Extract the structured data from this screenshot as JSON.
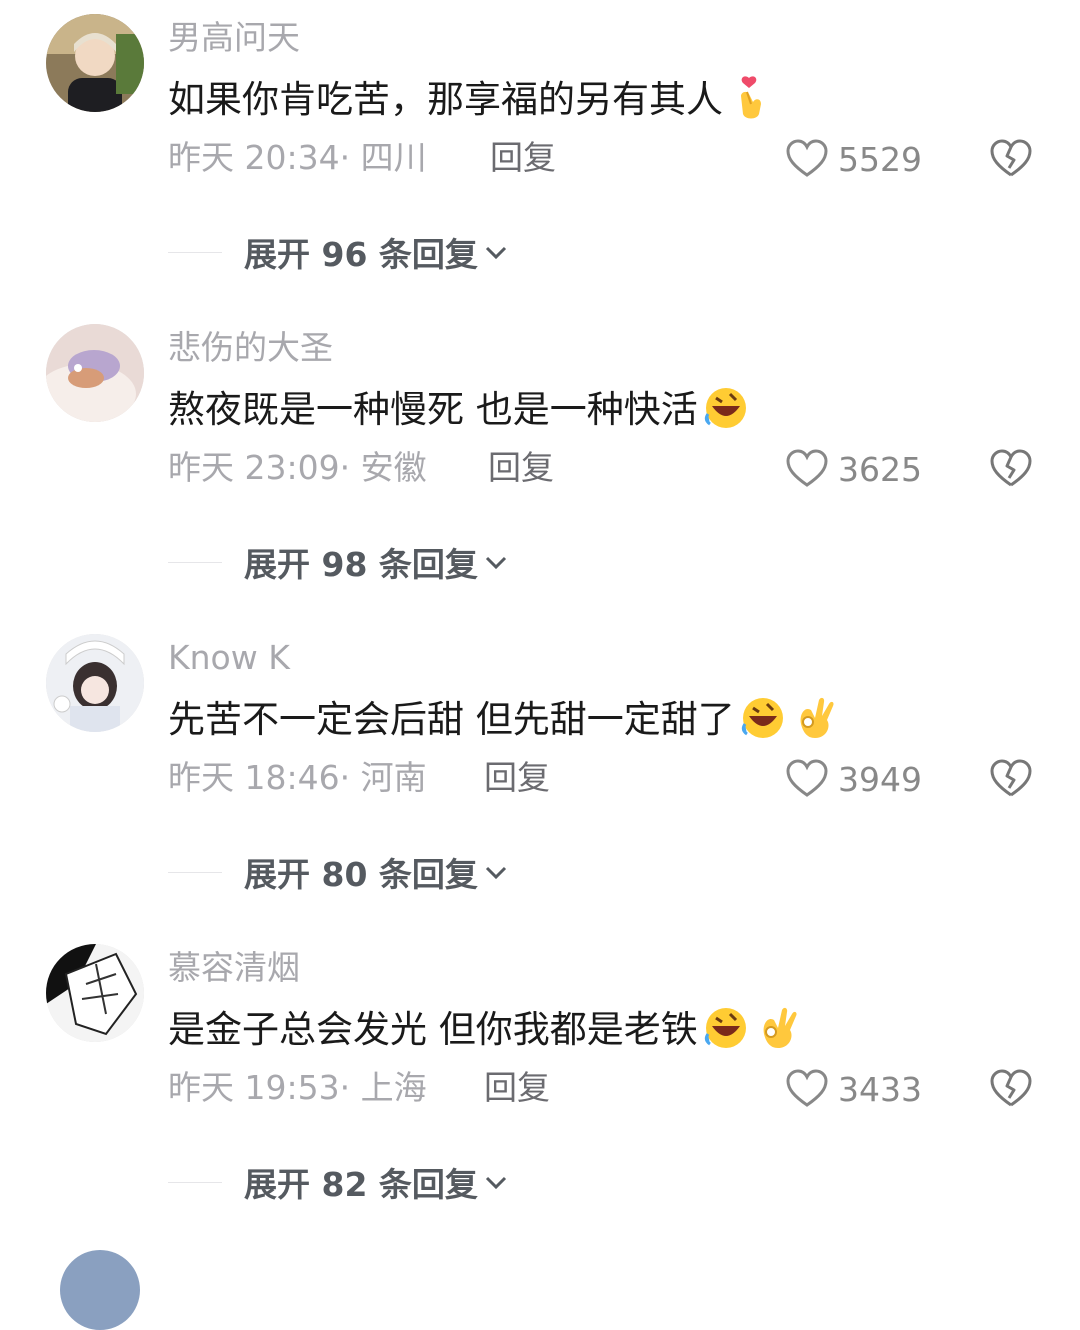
{
  "comments": [
    {
      "username": "男高问天",
      "text": "如果你肯吃苦，那享福的另有其人",
      "emojis": [
        "finger-heart-emoji"
      ],
      "meta": "昨天 20:34· 四川",
      "reply_label": "回复",
      "likes": "5529",
      "expand_label": "展开 96 条回复"
    },
    {
      "username": "悲伤的大圣",
      "text": "熬夜既是一种慢死 也是一种快活",
      "emojis": [
        "rolling-laughing-emoji"
      ],
      "meta": "昨天 23:09· 安徽",
      "reply_label": "回复",
      "likes": "3625",
      "expand_label": "展开 98 条回复"
    },
    {
      "username": "Know K",
      "text": "先苦不一定会后甜 但先甜一定甜了",
      "emojis": [
        "rolling-laughing-emoji",
        "ok-hand-emoji"
      ],
      "meta": "昨天 18:46· 河南",
      "reply_label": "回复",
      "likes": "3949",
      "expand_label": "展开 80 条回复"
    },
    {
      "username": "慕容清烟",
      "text": "是金子总会发光 但你我都是老铁",
      "emojis": [
        "rolling-laughing-emoji",
        "ok-hand-emoji"
      ],
      "meta": "昨天 19:53· 上海",
      "reply_label": "回复",
      "likes": "3433",
      "expand_label": "展开 82 条回复"
    }
  ],
  "colors": {
    "secondary_text": "#a8a8ad",
    "primary_text": "#1a1a1a",
    "reply_text": "#6b6b70",
    "expand_text": "#555a60"
  }
}
